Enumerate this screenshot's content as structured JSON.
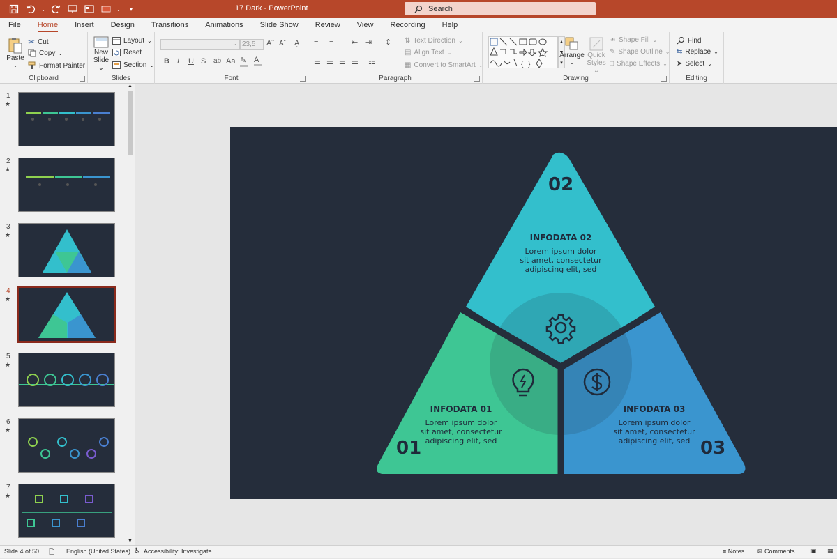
{
  "window": {
    "doc_title": "17 Dark  -  PowerPoint",
    "search_placeholder": "Search",
    "accent": "#b7472a"
  },
  "tabs": [
    "File",
    "Home",
    "Insert",
    "Design",
    "Transitions",
    "Animations",
    "Slide Show",
    "Review",
    "View",
    "Recording",
    "Help"
  ],
  "active_tab": "Home",
  "ribbon": {
    "clipboard": {
      "paste": "Paste",
      "cut": "Cut",
      "copy": "Copy",
      "format_painter": "Format Painter",
      "label": "Clipboard"
    },
    "slides": {
      "new_slide_line1": "New",
      "new_slide_line2": "Slide",
      "layout": "Layout",
      "reset": "Reset",
      "section": "Section",
      "label": "Slides"
    },
    "font": {
      "font_size": "23,5",
      "label": "Font"
    },
    "paragraph": {
      "text_direction": "Text Direction",
      "align_text": "Align Text",
      "convert_smartart": "Convert to SmartArt",
      "label": "Paragraph"
    },
    "drawing": {
      "arrange": "Arrange",
      "quick_styles_line1": "Quick",
      "quick_styles_line2": "Styles",
      "shape_fill": "Shape Fill",
      "shape_outline": "Shape Outline",
      "shape_effects": "Shape Effects",
      "label": "Drawing"
    },
    "editing": {
      "find": "Find",
      "replace": "Replace",
      "select": "Select",
      "label": "Editing"
    }
  },
  "thumbnails": [
    {
      "num": "1",
      "star": "★"
    },
    {
      "num": "2",
      "star": "★"
    },
    {
      "num": "3",
      "star": "★"
    },
    {
      "num": "4",
      "star": "★"
    },
    {
      "num": "5",
      "star": "★"
    },
    {
      "num": "6",
      "star": "★"
    },
    {
      "num": "7",
      "star": "★"
    }
  ],
  "selected_slide": "4",
  "slide": {
    "background": "#252d3b",
    "sections": [
      {
        "number": "02",
        "title": "INFODATA 02",
        "body_line1": "Lorem ipsum dolor",
        "body_line2": "sit amet, consectetur",
        "body_line3": "adipiscing elit, sed",
        "color": "#33bfcc",
        "icon": "gear-icon"
      },
      {
        "number": "01",
        "title": "INFODATA 01",
        "body_line1": "Lorem ipsum dolor",
        "body_line2": "sit amet, consectetur",
        "body_line3": "adipiscing elit, sed",
        "color": "#3ec694",
        "icon": "lightbulb-icon"
      },
      {
        "number": "03",
        "title": "INFODATA 03",
        "body_line1": "Lorem ipsum dolor",
        "body_line2": "sit amet, consectetur",
        "body_line3": "adipiscing elit, sed",
        "color": "#3a95cf",
        "icon": "dollar-icon"
      }
    ]
  },
  "status": {
    "slide_info": "Slide 4 of 50",
    "language": "English (United States)",
    "accessibility": "Accessibility: Investigate",
    "notes": "Notes",
    "comments": "Comments"
  }
}
